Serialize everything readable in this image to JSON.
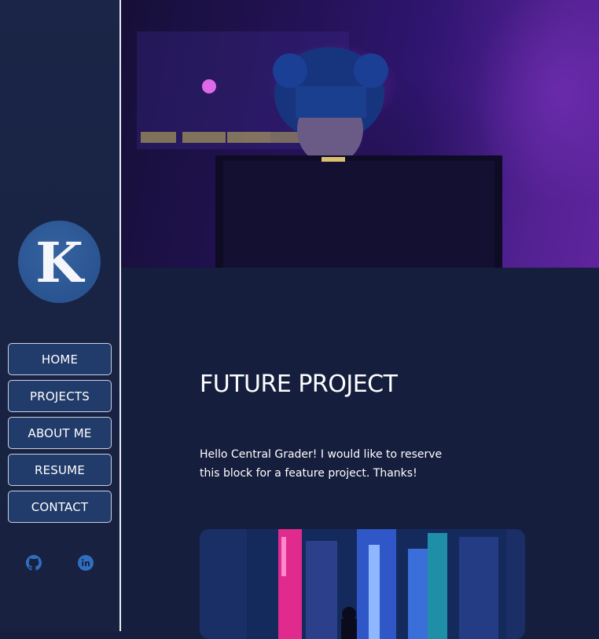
{
  "sidebar": {
    "logo_letter": "K",
    "nav": [
      {
        "label": "HOME"
      },
      {
        "label": "PROJECTS"
      },
      {
        "label": "ABOUT ME"
      },
      {
        "label": "RESUME"
      },
      {
        "label": "CONTACT"
      }
    ],
    "social": [
      {
        "icon": "github-icon"
      },
      {
        "icon": "linkedin-icon"
      }
    ]
  },
  "main": {
    "title": "FUTURE PROJECT",
    "text": "Hello Central Grader! I would like to reserve this block for a feature project. Thanks!"
  },
  "colors": {
    "background": "#161e3d",
    "sidebar": "#1a2547",
    "accent": "#2a5491",
    "button": "#213b6a"
  }
}
